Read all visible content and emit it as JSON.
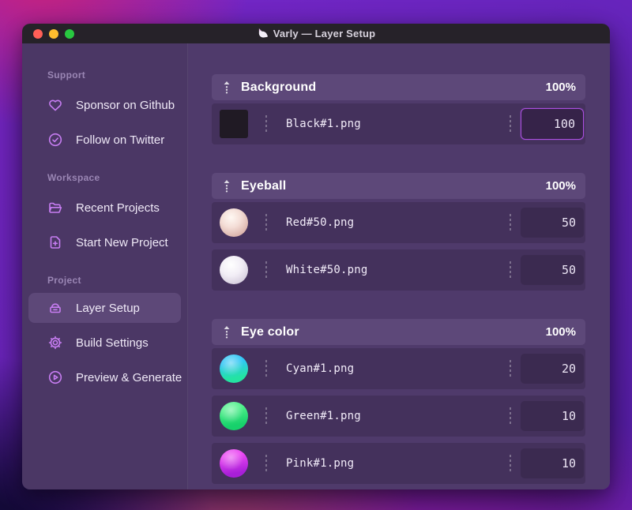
{
  "window": {
    "title": "Varly — Layer Setup",
    "app_icon": "unicorn-icon",
    "traffic_lights": {
      "close": "#ff5f57",
      "minimize": "#febc2e",
      "zoom": "#28c840"
    }
  },
  "sidebar": {
    "sections": [
      {
        "label": "Support",
        "items": [
          {
            "icon": "heart-icon",
            "label": "Sponsor on Github"
          },
          {
            "icon": "badge-check-icon",
            "label": "Follow on Twitter"
          }
        ]
      },
      {
        "label": "Workspace",
        "items": [
          {
            "icon": "folder-icon",
            "label": "Recent Projects"
          },
          {
            "icon": "document-plus-icon",
            "label": "Start New Project"
          }
        ]
      },
      {
        "label": "Project",
        "items": [
          {
            "icon": "layers-icon",
            "label": "Layer Setup",
            "active": true
          },
          {
            "icon": "gear-icon",
            "label": "Build Settings"
          },
          {
            "icon": "play-circle-icon",
            "label": "Preview & Generate"
          }
        ]
      }
    ]
  },
  "main": {
    "groups": [
      {
        "name": "Background",
        "weight": "100%",
        "rows": [
          {
            "filename": "Black#1.png",
            "value": "100",
            "focused": true,
            "thumb_css": "background:#201a24"
          }
        ]
      },
      {
        "name": "Eyeball",
        "weight": "100%",
        "rows": [
          {
            "filename": "Red#50.png",
            "value": "50",
            "thumb_css": "background:radial-gradient(circle at 40% 32%, #fff8f3 0%, #f4ded7 38%, #dcb5ad 75%, #c49b96 100%)"
          },
          {
            "filename": "White#50.png",
            "value": "50",
            "thumb_css": "background:radial-gradient(circle at 40% 32%, #ffffff 0%, #f2eef6 42%, #d6cede 78%, #beb5cb 100%)"
          }
        ]
      },
      {
        "name": "Eye color",
        "weight": "100%",
        "rows": [
          {
            "filename": "Cyan#1.png",
            "value": "20",
            "thumb_css": "background:radial-gradient(circle at 40% 30%, rgba(255,255,255,.5), rgba(255,255,255,0) 48%), linear-gradient(170deg, #30c6f5 30%, #24e3a2 78%)"
          },
          {
            "filename": "Green#1.png",
            "value": "10",
            "thumb_css": "background:radial-gradient(circle at 40% 30%, rgba(255,255,255,.5), rgba(255,255,255,0) 48%), linear-gradient(170deg, #4ef08a 25%, #17d16b 78%)"
          },
          {
            "filename": "Pink#1.png",
            "value": "10",
            "thumb_css": "background:radial-gradient(circle at 40% 30%, rgba(255,255,255,.45), rgba(255,255,255,0) 48%), linear-gradient(170deg, #ea47f2 25%, #a81fd8 80%)"
          }
        ]
      }
    ]
  },
  "colors": {
    "accent": "#c77df2",
    "focus_border": "#ab4fe0",
    "sidebar_bg": "#4b3765",
    "main_bg": "#4f3a6b",
    "group_header_bg": "#5d4879",
    "row_bg": "#44315c",
    "input_bg": "#3b2a50",
    "titlebar_bg": "#262229"
  }
}
